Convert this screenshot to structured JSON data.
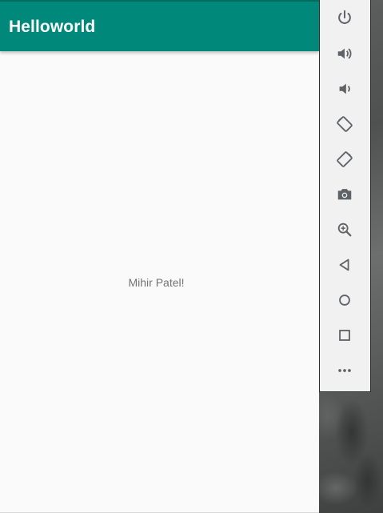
{
  "app": {
    "title": "Helloworld",
    "accent_color": "#00897b"
  },
  "content": {
    "text": "Mihir Patel!"
  },
  "toolbar": {
    "icons": [
      "power-icon",
      "volume-up-icon",
      "volume-down-icon",
      "rotate-left-icon",
      "rotate-right-icon",
      "camera-icon",
      "zoom-icon",
      "back-icon",
      "home-icon",
      "overview-icon",
      "more-icon"
    ]
  }
}
